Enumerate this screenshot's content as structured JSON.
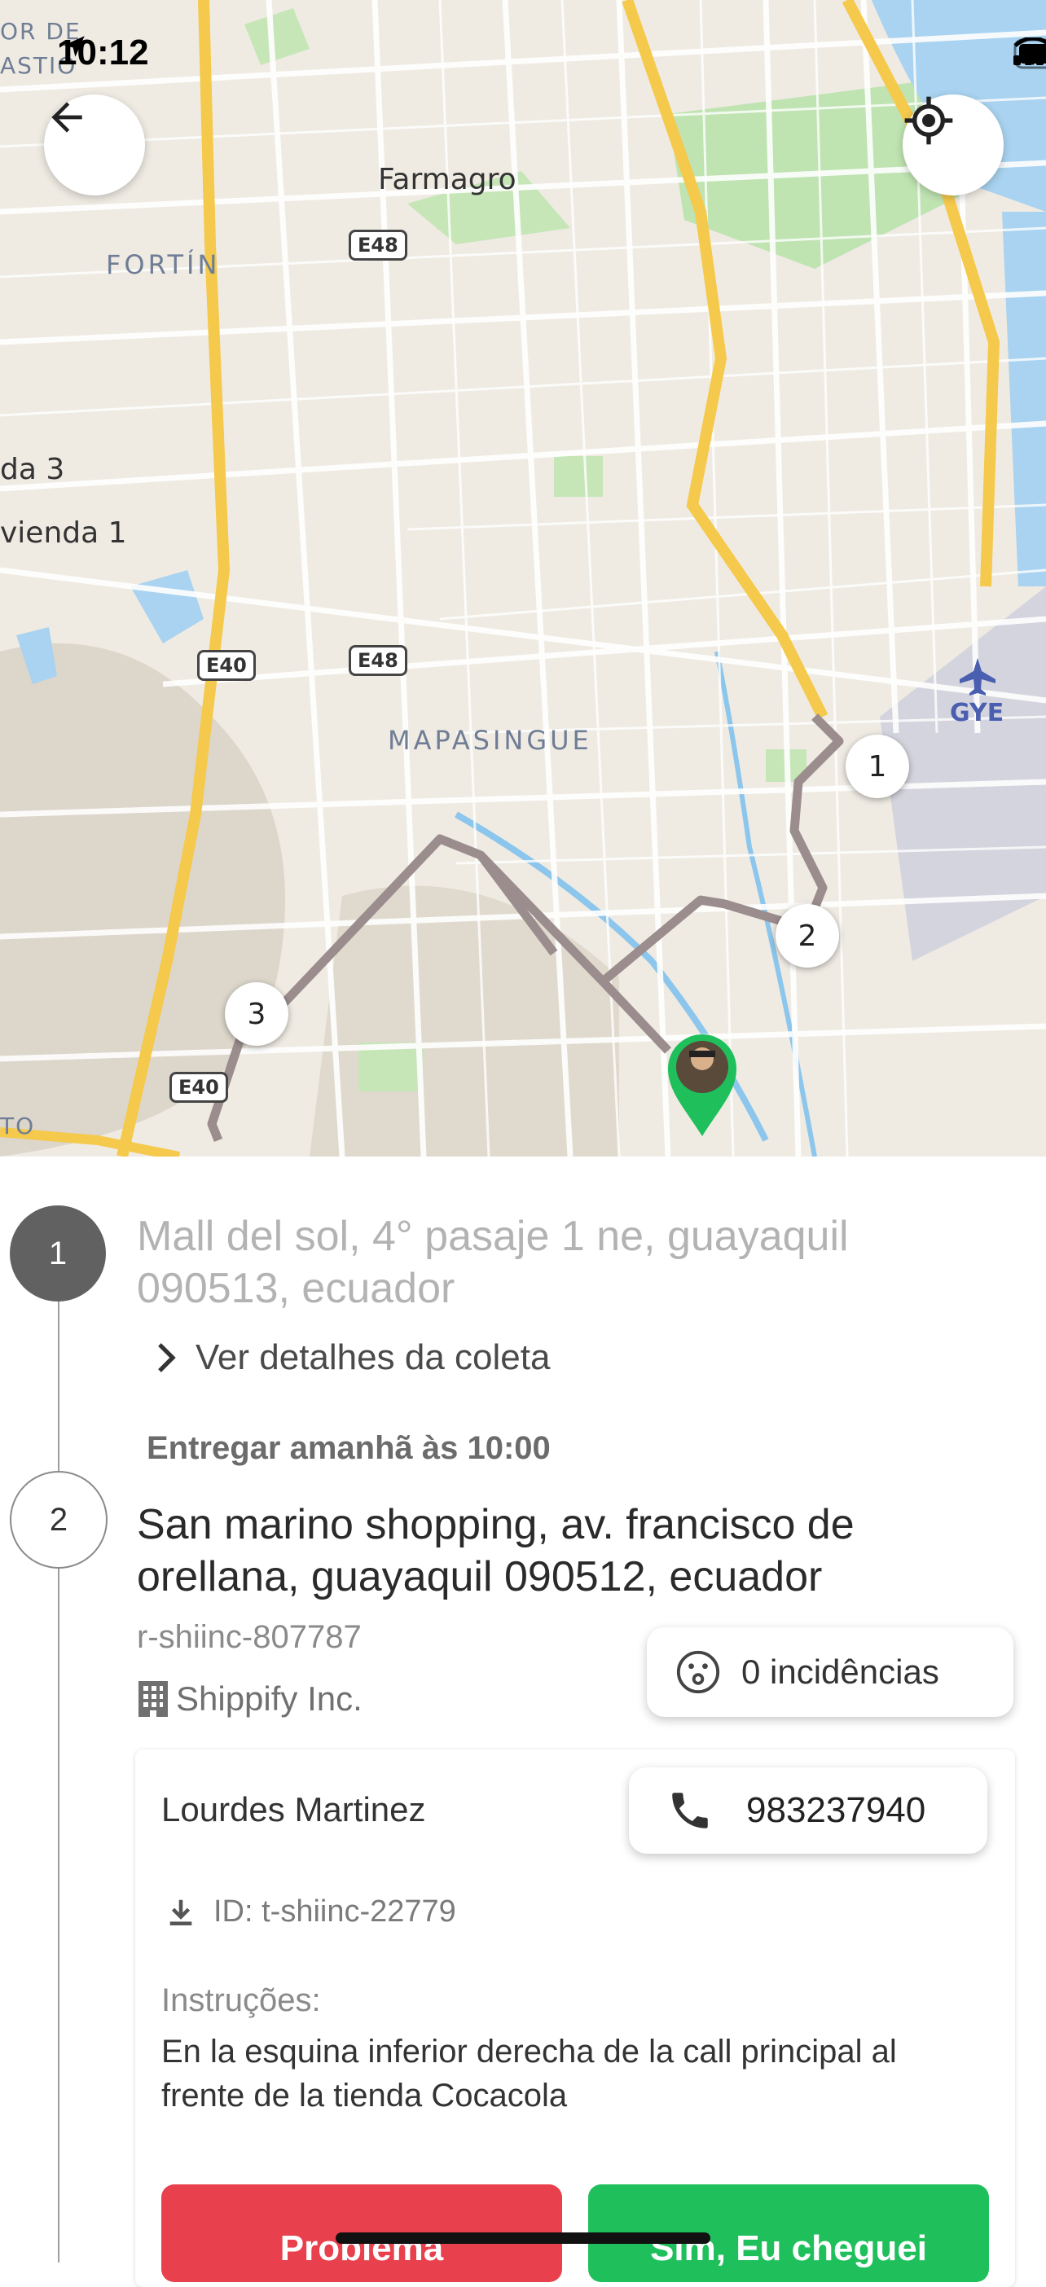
{
  "status_bar": {
    "time": "10:12"
  },
  "map": {
    "labels": {
      "farmagro": "Farmagro",
      "fortin": "FORTÍN",
      "mapasingue": "MAPASINGUE",
      "da3": "da 3",
      "vivienda1": "vienda 1",
      "gye": "GYE",
      "corner_top1": "OR DE",
      "corner_top2": "ASTIO",
      "corner_bottom": "TO"
    },
    "shields": {
      "e48_top": "E48",
      "e48_mid": "E48",
      "e40_mid": "E40",
      "e40_low": "E40"
    },
    "stops": [
      "1",
      "2",
      "3"
    ]
  },
  "route": {
    "step1": {
      "number": "1",
      "address": "Mall del sol, 4° pasaje 1 ne, guayaquil 090513, ecuador",
      "details_link": "Ver detalhes da coleta"
    },
    "step2": {
      "number": "2",
      "deliver_time": "Entregar amanhã às 10:00",
      "address": "San marino shopping, av. francisco de orellana, guayaquil 090512, ecuador",
      "reference": "r-shiinc-807787",
      "company": "Shippify Inc.",
      "incidents": "0 incidências",
      "contact_name": "Lourdes Martinez",
      "phone": "983237940",
      "tracking_id": "ID: t-shiinc-22779",
      "instructions_label": "Instruções:",
      "instructions": "En la esquina inferior derecha de la call principal al frente de la tienda Cocacola"
    }
  },
  "actions": {
    "problem": "Problema",
    "arrived": "Sim, Eu cheguei"
  },
  "colors": {
    "route": "#9b8d8d",
    "pin": "#1fbf5c",
    "problem": "#e8404c",
    "arrived": "#1fc05c"
  }
}
